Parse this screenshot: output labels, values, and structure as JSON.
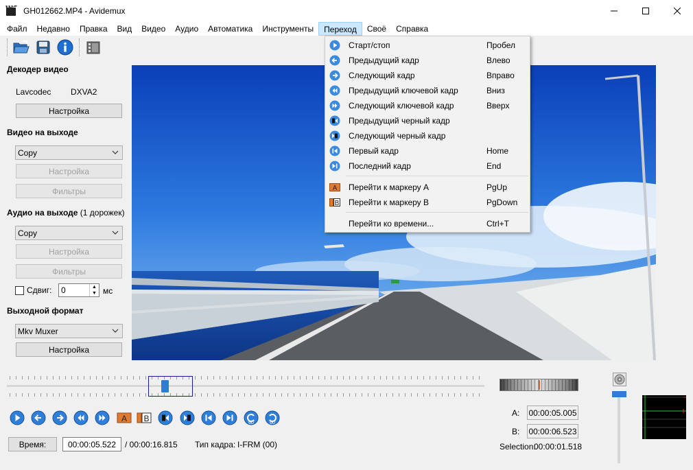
{
  "window": {
    "title": "GH012662.MP4 - Avidemux",
    "minimize": "minimize",
    "maximize": "maximize",
    "close": "close"
  },
  "menubar": {
    "items": [
      "Файл",
      "Недавно",
      "Правка",
      "Вид",
      "Видео",
      "Аудио",
      "Автоматика",
      "Инструменты",
      "Переход",
      "Своё",
      "Справка"
    ],
    "active_index": 8
  },
  "toolbar": {
    "icons": [
      "open-file-icon",
      "save-icon",
      "info-icon",
      "film-calculator-icon"
    ]
  },
  "left_panel": {
    "video_decoder": {
      "title": "Декодер видео",
      "decoder_name": "Lavcodec",
      "decoder_hw": "DXVA2",
      "configure_label": "Настройка"
    },
    "video_output": {
      "title": "Видео на выходе",
      "codec": "Copy",
      "configure_label": "Настройка",
      "filters_label": "Фильтры"
    },
    "audio_output": {
      "title": "Аудио на выходе",
      "title_suffix": "(1 дорожек)",
      "codec": "Copy",
      "configure_label": "Настройка",
      "filters_label": "Фильтры",
      "shift_label": "Сдвиг:",
      "shift_value": "0",
      "shift_unit": "мс"
    },
    "output_format": {
      "title": "Выходной формат",
      "muxer": "Mkv Muxer",
      "configure_label": "Настройка"
    }
  },
  "go_menu": {
    "items": [
      {
        "label": "Старт/стоп",
        "shortcut": "Пробел",
        "icon": "play-icon"
      },
      {
        "label": "Предыдущий кадр",
        "shortcut": "Влево",
        "icon": "previous-frame-icon"
      },
      {
        "label": "Следующий кадр",
        "shortcut": "Вправо",
        "icon": "next-frame-icon"
      },
      {
        "label": "Предыдущий ключевой кадр",
        "shortcut": "Вниз",
        "icon": "previous-keyframe-icon"
      },
      {
        "label": "Следующий ключевой кадр",
        "shortcut": "Вверх",
        "icon": "next-keyframe-icon"
      },
      {
        "label": "Предыдущий черный кадр",
        "shortcut": "",
        "icon": "previous-black-frame-icon"
      },
      {
        "label": "Следующий черный кадр",
        "shortcut": "",
        "icon": "next-black-frame-icon"
      },
      {
        "label": "Первый кадр",
        "shortcut": "Home",
        "icon": "first-frame-icon"
      },
      {
        "label": "Последний кадр",
        "shortcut": "End",
        "icon": "last-frame-icon"
      },
      {
        "label": "Перейти к маркеру A",
        "shortcut": "PgUp",
        "icon": "marker-a-icon"
      },
      {
        "label": "Перейти к маркеру B",
        "shortcut": "PgDown",
        "icon": "marker-b-icon"
      },
      {
        "label": "Перейти ко времени...",
        "shortcut": "Ctrl+T",
        "icon": ""
      }
    ]
  },
  "playback": {
    "time_button": "Время:",
    "current_time": "00:00:05.522",
    "total_time": "/ 00:00:16.815",
    "frame_type_label": "Тип кадра:",
    "frame_type": "I-FRM (00)",
    "marker_a_label": "A:",
    "marker_a": "00:00:05.005",
    "marker_b_label": "B:",
    "marker_b": "00:00:06.523",
    "selection_label": "Selection:",
    "selection": "00:00:01.518",
    "position_fraction": 0.33,
    "controls": [
      "play-icon",
      "previous-frame-icon",
      "next-frame-icon",
      "previous-keyframe-icon",
      "next-keyframe-icon",
      "set-marker-a-icon",
      "set-marker-b-icon",
      "previous-black-frame-icon",
      "next-black-frame-icon",
      "first-frame-icon",
      "last-frame-icon",
      "back-60s-icon",
      "forward-60s-icon"
    ]
  }
}
